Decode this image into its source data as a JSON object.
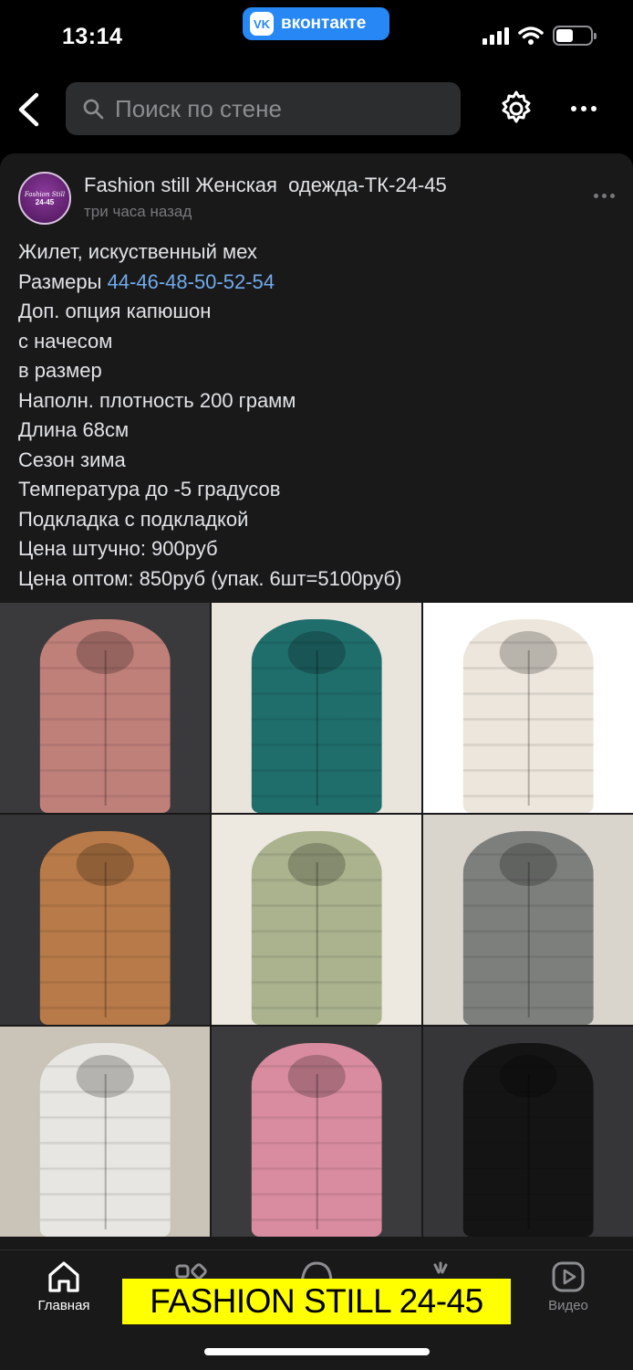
{
  "status_bar": {
    "time": "13:14",
    "vk_label": "вконтакте",
    "vk_logo": "VK"
  },
  "nav": {
    "search_placeholder": "Поиск по стене",
    "icons": [
      "chevron-left-icon",
      "search-icon",
      "gear-icon",
      "more-icon"
    ]
  },
  "post": {
    "author": "Fashion still Женская  одежда-ТК-24-45",
    "time": "три часа назад",
    "avatar": {
      "line1": "Fashion Still",
      "line2": "24-45"
    },
    "lines": [
      "Жилет, искуственный мех",
      "Размеры ",
      "Доп. опция капюшон",
      "с начесом",
      "в размер",
      "Наполн. плотность 200 грамм",
      "Длина 68см",
      "Сезон зима",
      "Температура до -5 градусов",
      "Подкладка с подкладкой",
      "Цена штучно: 900руб",
      "Цена оптом: 850руб (упак. 6шт=5100руб)"
    ],
    "sizes_link": "44-46-48-50-52-54",
    "photos": [
      {
        "vest": "#c0807a",
        "bg": "#3a3a3c"
      },
      {
        "vest": "#1f6e6c",
        "bg": "#e9e4dc"
      },
      {
        "vest": "#ece6dc",
        "bg": "#ffffff"
      },
      {
        "vest": "#b87a48",
        "bg": "#353537"
      },
      {
        "vest": "#aab38e",
        "bg": "#ede8e0"
      },
      {
        "vest": "#7d7f7d",
        "bg": "#d9d4cc"
      },
      {
        "vest": "#e8e6e2",
        "bg": "#c9c3b8"
      },
      {
        "vest": "#d98c9f",
        "bg": "#3b3b3d"
      },
      {
        "vest": "#141414",
        "bg": "#363638"
      }
    ]
  },
  "tabbar": {
    "home_label": "Главная",
    "video_label": "Видео",
    "icons": [
      "home-icon",
      "services-icon",
      "messages-icon",
      "clips-icon",
      "video-icon"
    ]
  },
  "banner": "FASHION STILL 24-45",
  "colors": {
    "background": "#000000",
    "card": "#19191a",
    "link": "#71aaeb",
    "vk_blue": "#2787f5",
    "banner": "#ffff00"
  }
}
